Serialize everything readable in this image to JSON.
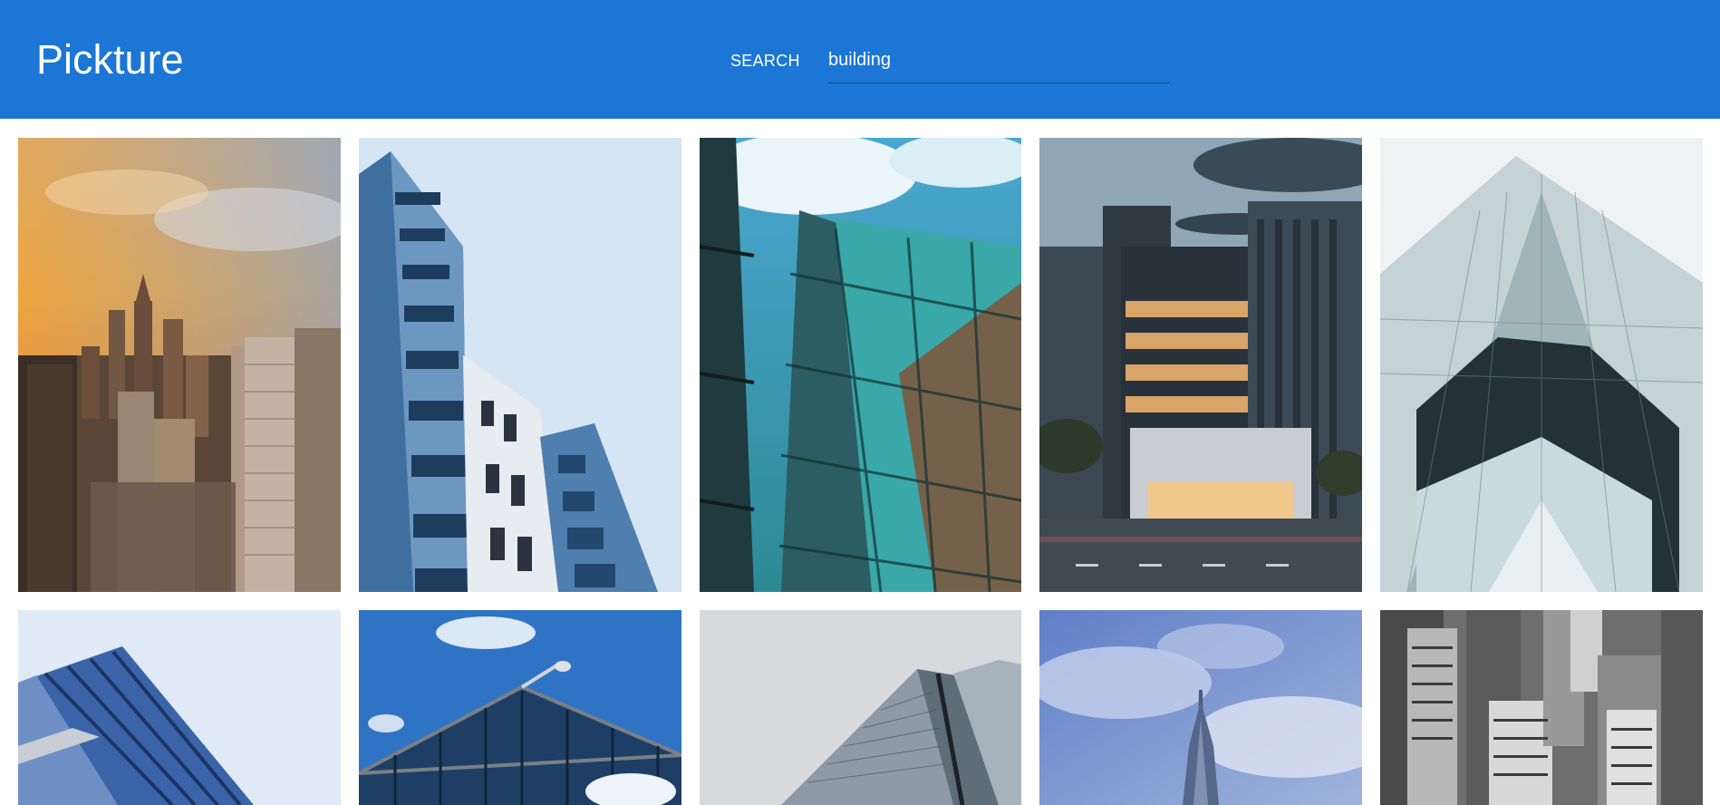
{
  "app": {
    "title": "Pickture"
  },
  "search": {
    "label": "SEARCH",
    "value": "building",
    "placeholder": ""
  },
  "results": {
    "query": "building",
    "images": [
      {
        "subject": "city-skyline-sunset"
      },
      {
        "subject": "blue-glass-facade"
      },
      {
        "subject": "glass-tower-cloud-reflection"
      },
      {
        "subject": "office-building-street-dusk"
      },
      {
        "subject": "glass-skyscraper-looking-up"
      },
      {
        "subject": "blue-office-block-corner"
      },
      {
        "subject": "glass-roof-with-camera"
      },
      {
        "subject": "grey-glass-towers"
      },
      {
        "subject": "burj-tower-blue-sky"
      },
      {
        "subject": "monochrome-city-towers"
      }
    ]
  },
  "colors": {
    "appbar": "#1b76d6",
    "appbar_text": "#ffffff",
    "background": "#ffffff"
  }
}
